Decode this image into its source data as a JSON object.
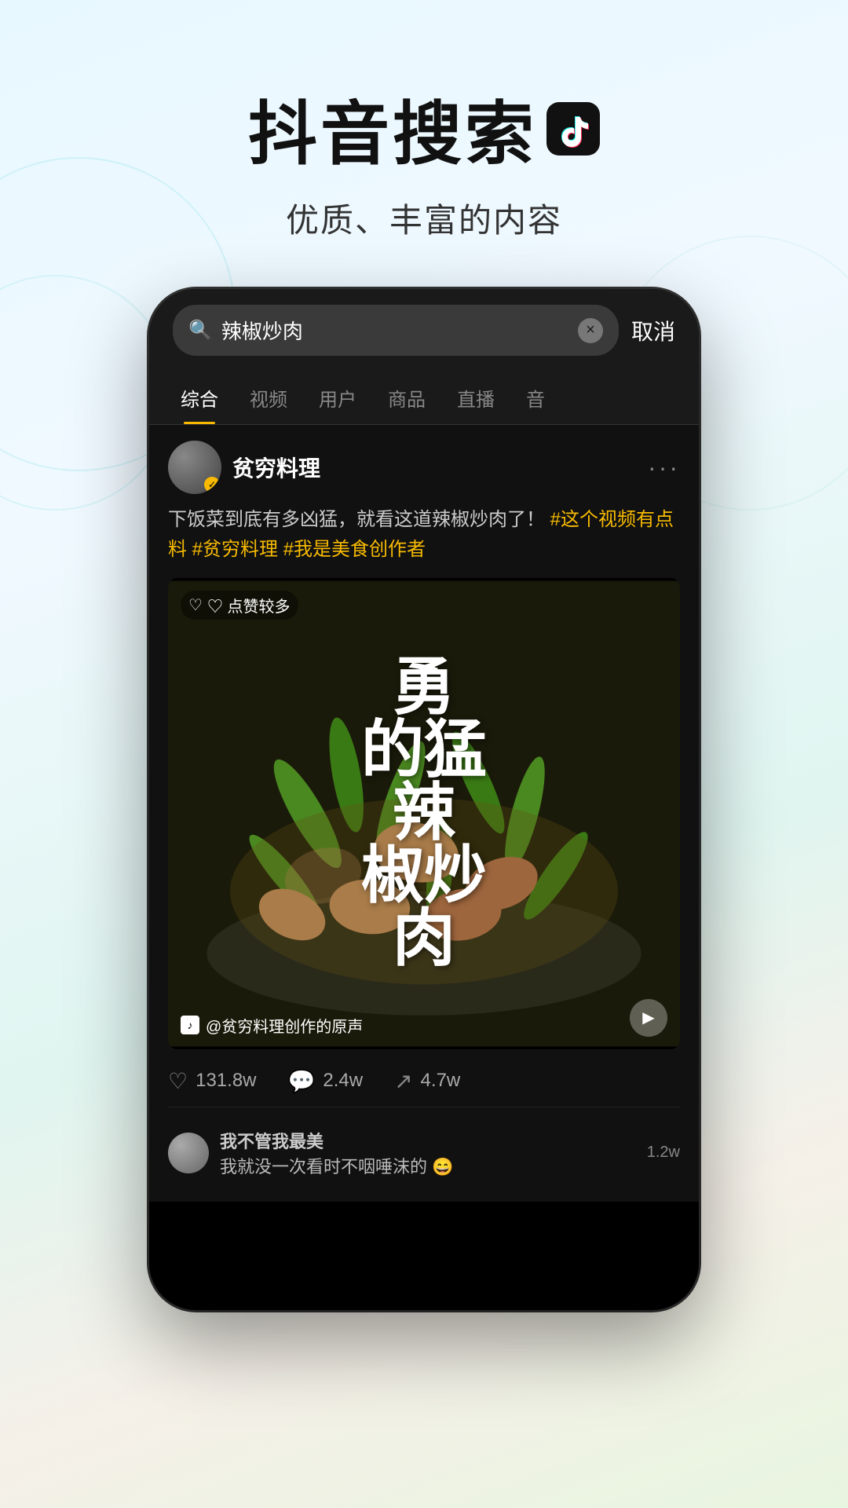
{
  "header": {
    "main_title": "抖音搜索",
    "subtitle": "优质、丰富的内容"
  },
  "phone": {
    "search_bar": {
      "query": "辣椒炒肉",
      "clear_label": "×",
      "cancel_label": "取消"
    },
    "tabs": [
      {
        "label": "综合",
        "active": true
      },
      {
        "label": "视频",
        "active": false
      },
      {
        "label": "用户",
        "active": false
      },
      {
        "label": "商品",
        "active": false
      },
      {
        "label": "直播",
        "active": false
      },
      {
        "label": "音",
        "active": false
      }
    ],
    "post": {
      "username": "贫穷料理",
      "verified": true,
      "more_label": "···",
      "text": "下饭菜到底有多凶猛，就看这道辣椒炒肉了！",
      "hashtags": [
        "#这个视频有点料",
        "#贫穷料理",
        "#我是美食创作者"
      ],
      "likes_badge": "♡ 点赞较多",
      "video_title": "勇\n的猛\n辣\n椒炒\n肉",
      "sound_text": "@贫穷料理创作的原声",
      "stats": [
        {
          "icon": "♡",
          "value": "131.8w"
        },
        {
          "icon": "💬",
          "value": "2.4w"
        },
        {
          "icon": "↗",
          "value": "4.7w"
        }
      ],
      "comments": [
        {
          "username": "我不管我最美",
          "text": "我就没一次看时不咽唾沫的 😄",
          "count": "1.2w"
        }
      ]
    }
  }
}
